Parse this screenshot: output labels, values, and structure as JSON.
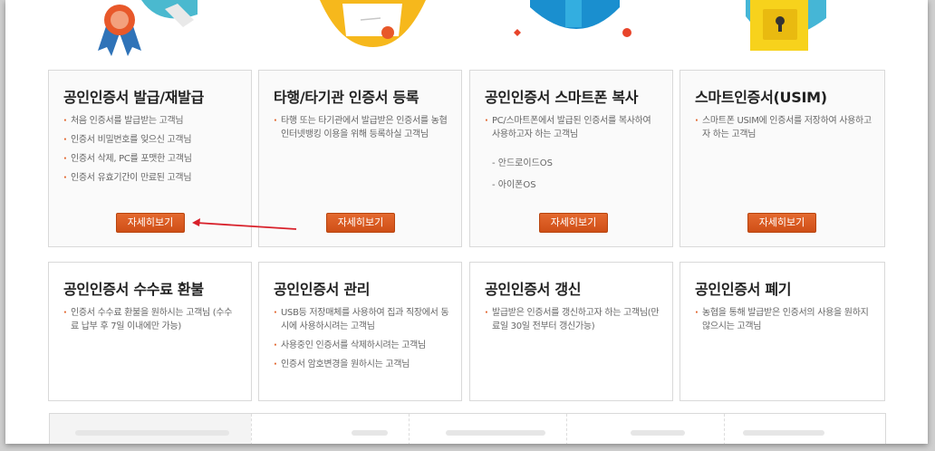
{
  "cards": [
    {
      "title": "공인인증서 발급/재발급",
      "items": [
        "처음 인증서를 발급받는 고객님",
        "인증서 비밀번호를 잊으신 고객님",
        "인증서 삭제, PC를 포맷한 고객님",
        "인증서 유효기간이 만료된 고객님"
      ],
      "button": "자세히보기"
    },
    {
      "title": "타행/타기관 인증서 등록",
      "items": [
        "타행 또는 타기관에서 발급받은 인증서를 농협 인터넷뱅킹 이용을 위해 등록하실 고객님"
      ],
      "button": "자세히보기"
    },
    {
      "title": "공인인증서 스마트폰 복사",
      "items": [
        "PC/스마트폰에서 발급된 인증서를 복사하여 사용하고자 하는 고객님"
      ],
      "subitems": [
        "- 안드로이드OS",
        "- 아이폰OS"
      ],
      "button": "자세히보기"
    },
    {
      "title": "스마트인증서(USIM)",
      "items": [
        "스마트폰 USIM에 인증서를 저장하여 사용하고자 하는 고객님"
      ],
      "button": "자세히보기"
    },
    {
      "title": "공인인증서 수수료 환불",
      "items": [
        "인증서 수수료 환불을 원하시는 고객님 (수수료 납부 후 7일 이내에만 가능)"
      ]
    },
    {
      "title": "공인인증서 관리",
      "items": [
        "USB등 저장매체를 사용하여 집과 직장에서 동시에 사용하시려는 고객님",
        "사용중인 인증서를 삭제하시려는 고객님",
        "인증서 암호변경을 원하시는 고객님"
      ]
    },
    {
      "title": "공인인증서 갱신",
      "items": [
        "발급받은 인증서를 갱신하고자 하는 고객님(만료일 30일 전부터 갱신가능)"
      ]
    },
    {
      "title": "공인인증서 폐기",
      "items": [
        "농협을 통해 발급받은 인증서의 사용을 원하지 않으시는 고객님"
      ]
    }
  ],
  "colors": {
    "accent": "#d9561b",
    "border": "#d9d9d9",
    "title": "#222222",
    "text": "#666666",
    "arrow": "#d8202a"
  },
  "icons": [
    "award-ribbon-icon",
    "certificate-icon",
    "smartphone-copy-icon",
    "usim-lock-icon"
  ]
}
